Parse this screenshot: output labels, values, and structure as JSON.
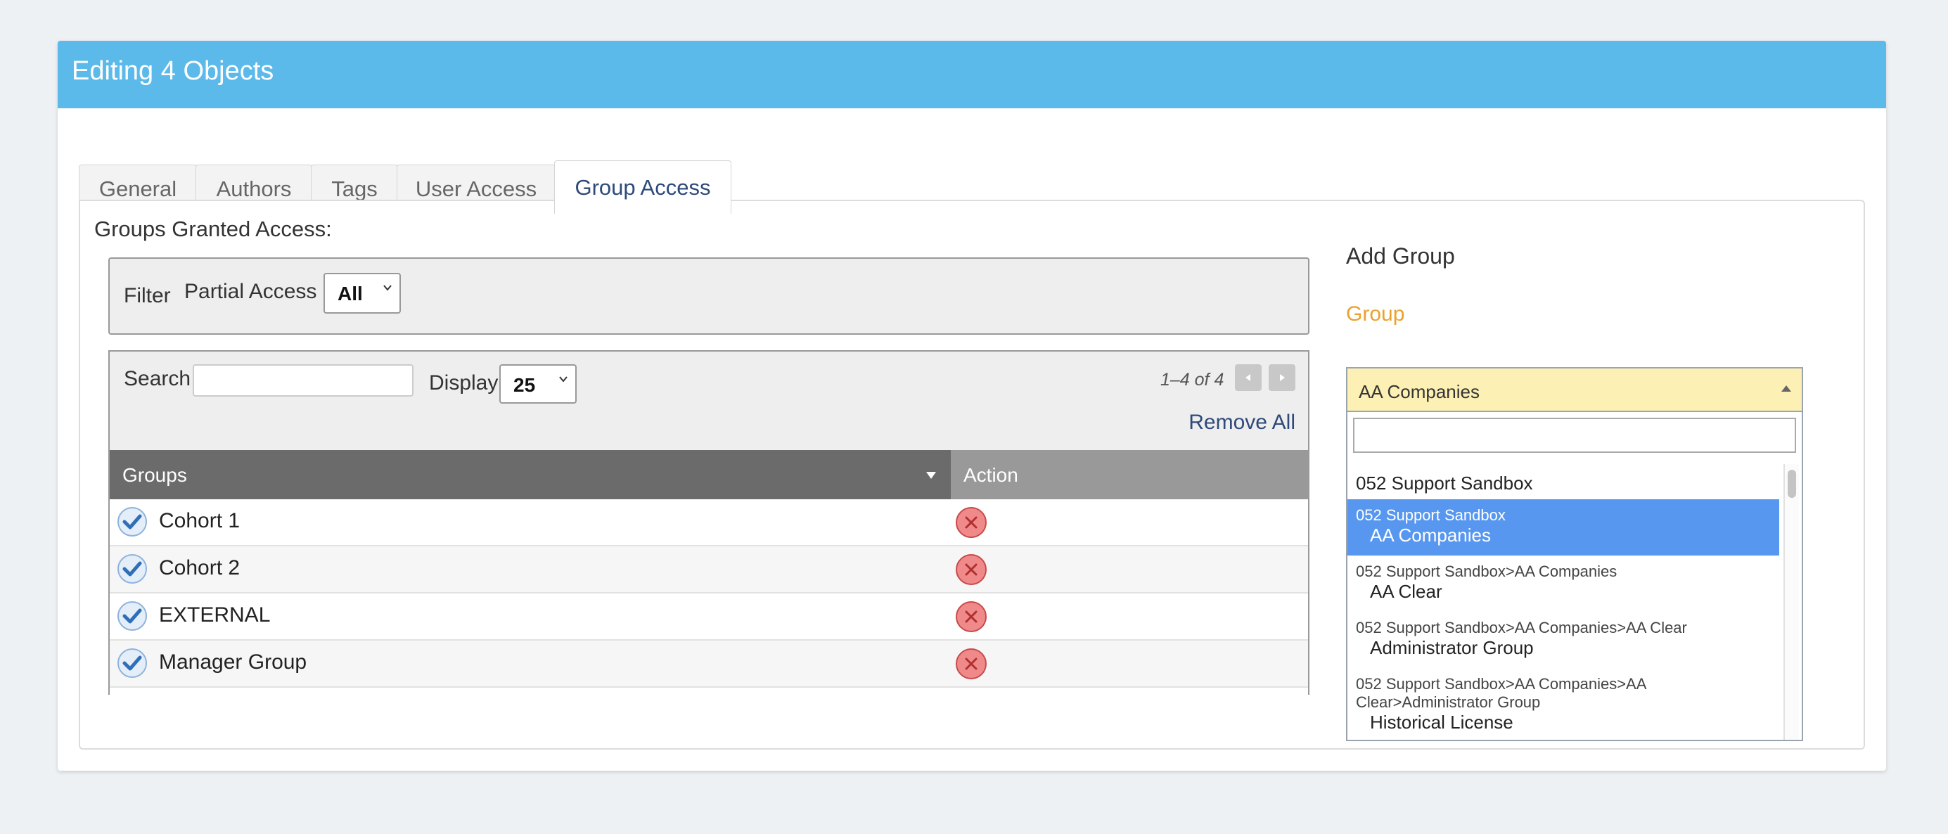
{
  "header": {
    "title": "Editing 4 Objects"
  },
  "tabs": [
    {
      "label": "General"
    },
    {
      "label": "Authors"
    },
    {
      "label": "Tags"
    },
    {
      "label": "User Access"
    },
    {
      "label": "Group Access",
      "active": true
    }
  ],
  "granted": {
    "title": "Groups Granted Access:",
    "filter": {
      "label": "Filter",
      "partial_label": "Partial Access",
      "partial_value": "All"
    },
    "toolbar": {
      "search_label": "Search",
      "search_value": "",
      "display_label": "Display",
      "display_value": "25",
      "pager_text": "1–4 of 4",
      "remove_all": "Remove All"
    },
    "columns": {
      "groups": "Groups",
      "action": "Action"
    },
    "rows": [
      {
        "label": "Cohort 1"
      },
      {
        "label": "Cohort 2"
      },
      {
        "label": "EXTERNAL"
      },
      {
        "label": "Manager Group"
      }
    ]
  },
  "add_group": {
    "title": "Add Group",
    "group_label": "Group",
    "selected": "AA Companies",
    "search_value": "",
    "options": [
      {
        "path": "",
        "name": "052 Support Sandbox"
      },
      {
        "path": "052 Support Sandbox",
        "name": "AA Companies",
        "selected": true
      },
      {
        "path": "052 Support Sandbox>AA Companies",
        "name": "AA Clear"
      },
      {
        "path": "052 Support Sandbox>AA Companies>AA Clear",
        "name": "Administrator Group"
      },
      {
        "path": "052 Support Sandbox>AA Companies>AA Clear>Administrator Group",
        "path_line1": "052 Support Sandbox>AA Companies>AA",
        "path_line2": "Clear>Administrator Group",
        "name": "Historical License"
      }
    ]
  },
  "colors": {
    "header_bg": "#5bbae9",
    "accent_link": "#2e4a7a",
    "group_label": "#e9a22b",
    "selected_option": "#5797ef",
    "combo_bg": "#fdf0b4",
    "remove_icon": "#f08a8a"
  },
  "icons": {
    "row_check": "check-circle-icon",
    "row_remove": "remove-circle-icon",
    "pager_prev": "triangle-left-icon",
    "pager_next": "triangle-right-icon",
    "sort": "sort-down-icon",
    "combo_caret": "caret-up-icon"
  }
}
